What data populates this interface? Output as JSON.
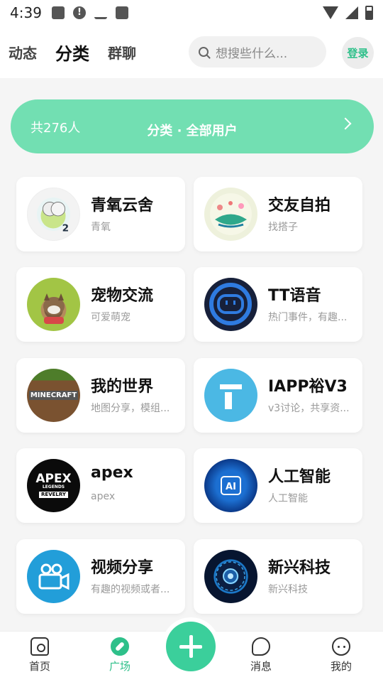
{
  "status": {
    "time": "4:39"
  },
  "topnav": {
    "tabs": [
      "动态",
      "分类",
      "群聊"
    ],
    "active_tab": "分类",
    "search_placeholder": "想搜些什么...",
    "login_label": "登录"
  },
  "banner": {
    "count": "共276人",
    "title": "分类 · 全部用户"
  },
  "categories": [
    {
      "name": "青氧云舍",
      "desc": "青氧",
      "icon": "qingyang-avatar-icon"
    },
    {
      "name": "交友自拍",
      "desc": "找搭子",
      "icon": "spring-day-avatar-icon"
    },
    {
      "name": "宠物交流",
      "desc": "可爱萌宠",
      "icon": "cat-avatar-icon"
    },
    {
      "name": "TT语音",
      "desc": "热门事件，有趣...",
      "icon": "tt-voice-icon"
    },
    {
      "name": "我的世界",
      "desc": "地图分享，模组...",
      "icon": "minecraft-icon",
      "avatar_text": "MINECRAFT"
    },
    {
      "name": "IAPP裕V3",
      "desc": "v3讨论，共享资...",
      "icon": "iapp-icon"
    },
    {
      "name": "apex",
      "desc": "apex",
      "icon": "apex-legends-icon",
      "avatar_text": "APEX",
      "avatar_sub": "LEGENDS",
      "avatar_badge": "REVELRY"
    },
    {
      "name": "人工智能",
      "desc": "人工智能",
      "icon": "ai-chip-icon",
      "avatar_text": "AI"
    },
    {
      "name": "视频分享",
      "desc": "有趣的视频或者...",
      "icon": "video-camera-icon"
    },
    {
      "name": "新兴科技",
      "desc": "新兴科技",
      "icon": "tech-circuit-icon"
    }
  ],
  "bottomnav": {
    "items": [
      {
        "label": "首页",
        "icon": "home-icon"
      },
      {
        "label": "广场",
        "icon": "compass-icon"
      },
      {
        "label": "消息",
        "icon": "message-icon"
      },
      {
        "label": "我的",
        "icon": "profile-icon"
      }
    ],
    "active": "广场",
    "fab_icon": "plus-icon"
  },
  "colors": {
    "accent": "#72dfb2",
    "accent_dark": "#2ec08a",
    "fab": "#3bcf9b"
  }
}
